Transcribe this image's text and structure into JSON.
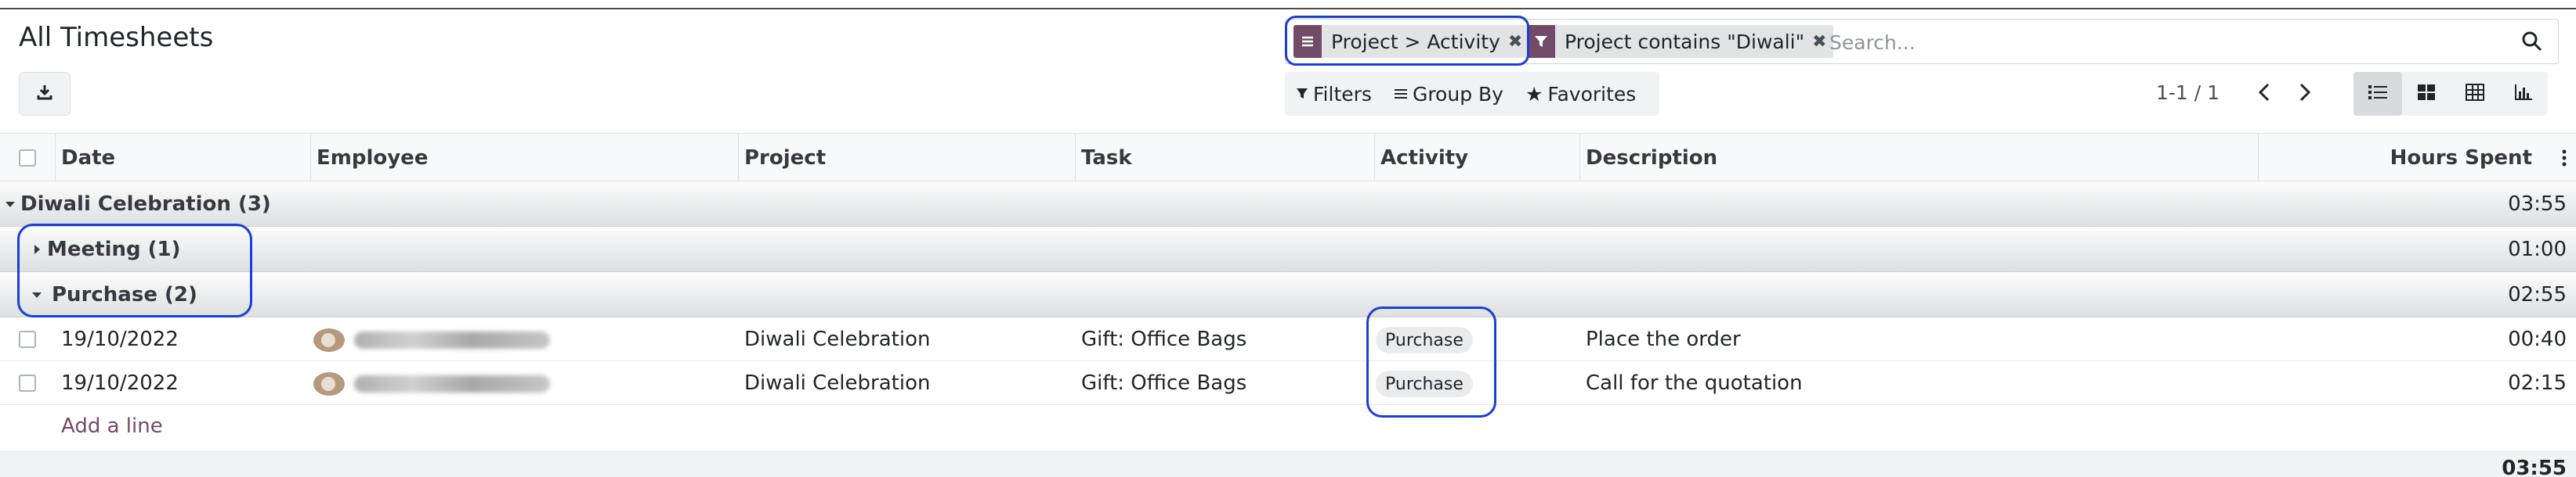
{
  "page": {
    "title": "All Timesheets"
  },
  "search": {
    "facets": [
      {
        "label": "Project > Activity",
        "icon": "group-by-icon"
      },
      {
        "label": "Project contains \"Diwali\"",
        "icon": "filter-icon"
      }
    ],
    "placeholder": "Search...",
    "accent": "#714b67"
  },
  "toolbar": {
    "filters_label": "Filters",
    "groupby_label": "Group By",
    "favorites_label": "Favorites"
  },
  "pager": {
    "value": "1-1 / 1"
  },
  "views": [
    "list-view-icon",
    "kanban-view-icon",
    "pivot-view-icon",
    "graph-view-icon"
  ],
  "table": {
    "columns": {
      "date": "Date",
      "employee": "Employee",
      "project": "Project",
      "task": "Task",
      "activity": "Activity",
      "description": "Description",
      "hours": "Hours Spent"
    },
    "groups": {
      "project": {
        "label": "Diwali Celebration (3)",
        "total": "03:55"
      },
      "meeting": {
        "label": "Meeting (1)",
        "total": "01:00"
      },
      "purchase": {
        "label": "Purchase (2)",
        "total": "02:55"
      }
    },
    "rows": [
      {
        "date": "19/10/2022",
        "project": "Diwali Celebration",
        "task": "Gift: Office Bags",
        "activity": "Purchase",
        "description": "Place the order",
        "hours": "00:40"
      },
      {
        "date": "19/10/2022",
        "project": "Diwali Celebration",
        "task": "Gift: Office Bags",
        "activity": "Purchase",
        "description": "Call for the quotation",
        "hours": "02:15"
      }
    ],
    "add_line": "Add a line",
    "grand_total": "03:55"
  }
}
